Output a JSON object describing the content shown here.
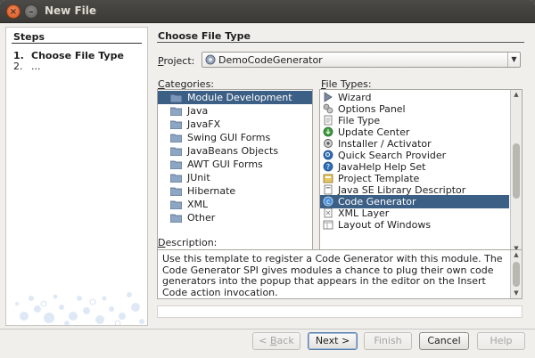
{
  "window": {
    "title": "New File"
  },
  "steps": {
    "title": "Steps",
    "items": [
      {
        "num": "1.",
        "label": "Choose File Type"
      },
      {
        "num": "2.",
        "label": "..."
      }
    ]
  },
  "main": {
    "title": "Choose File Type",
    "project": {
      "label_prefix": "P",
      "label_rest": "roject:",
      "value": "DemoCodeGenerator",
      "icon": "project-icon"
    },
    "categories": {
      "label_prefix": "C",
      "label_rest": "ategories:",
      "items": [
        {
          "label": "Module Development",
          "selected": true
        },
        {
          "label": "Java"
        },
        {
          "label": "JavaFX"
        },
        {
          "label": "Swing GUI Forms"
        },
        {
          "label": "JavaBeans Objects"
        },
        {
          "label": "AWT GUI Forms"
        },
        {
          "label": "JUnit"
        },
        {
          "label": "Hibernate"
        },
        {
          "label": "XML"
        },
        {
          "label": "Other"
        }
      ]
    },
    "file_types": {
      "label_prefix": "F",
      "label_rest": "ile Types:",
      "items": [
        {
          "label": "Wizard",
          "icon": "wizard-icon"
        },
        {
          "label": "Options Panel",
          "icon": "options-panel-icon"
        },
        {
          "label": "File Type",
          "icon": "file-type-icon"
        },
        {
          "label": "Update Center",
          "icon": "update-center-icon"
        },
        {
          "label": "Installer / Activator",
          "icon": "installer-icon"
        },
        {
          "label": "Quick Search Provider",
          "icon": "quick-search-icon"
        },
        {
          "label": "JavaHelp Help Set",
          "icon": "help-icon"
        },
        {
          "label": "Project Template",
          "icon": "project-template-icon"
        },
        {
          "label": "Java SE Library Descriptor",
          "icon": "library-icon"
        },
        {
          "label": "Code Generator",
          "icon": "code-generator-icon",
          "selected": true
        },
        {
          "label": "XML Layer",
          "icon": "xml-layer-icon"
        },
        {
          "label": "Layout of Windows",
          "icon": "layout-icon"
        }
      ]
    },
    "description": {
      "label_prefix": "D",
      "label_rest": "escription:",
      "text": "Use this template to register a Code Generator with this module. The Code Generator SPI gives modules a chance to plug their own code generators into the popup that appears in the editor on the Insert Code action invocation."
    }
  },
  "buttons": {
    "back": {
      "prefix": "< ",
      "mnemonic": "B",
      "rest": "ack",
      "enabled": false
    },
    "next": {
      "prefix": "Next ",
      "mnemonic": "",
      "rest": ">",
      "enabled": true
    },
    "finish": {
      "label": "Finish",
      "enabled": false
    },
    "cancel": {
      "label": "Cancel",
      "enabled": true
    },
    "help": {
      "label": "Help",
      "enabled": false
    }
  },
  "colors": {
    "selection": "#3c5f85",
    "titlebar": "#3f3e3a",
    "close": "#e3652f"
  }
}
